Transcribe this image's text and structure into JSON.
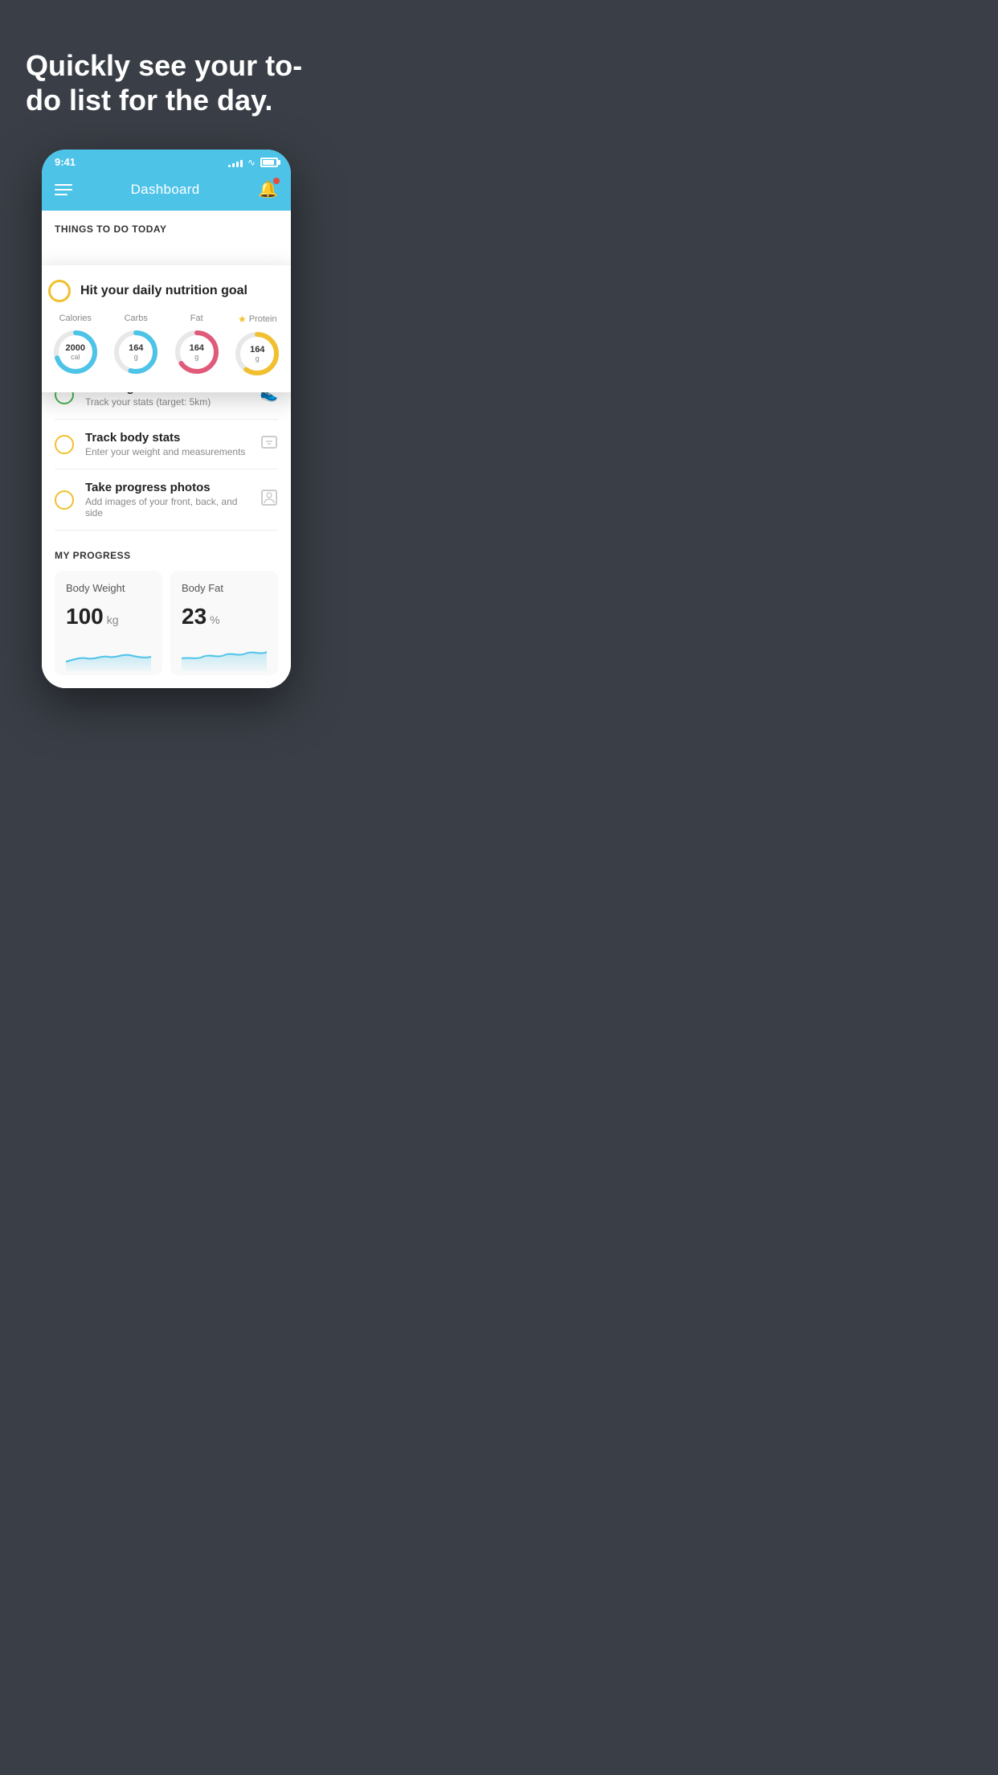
{
  "hero": {
    "title": "Quickly see your to-do list for the day."
  },
  "phone": {
    "status_bar": {
      "time": "9:41",
      "signal_bars": [
        3,
        5,
        7,
        9,
        11
      ],
      "battery_percent": 80
    },
    "header": {
      "title": "Dashboard",
      "menu_icon": "hamburger",
      "notification_icon": "bell"
    },
    "things_to_do": {
      "section_label": "THINGS TO DO TODAY"
    },
    "nutrition_card": {
      "title": "Hit your daily nutrition goal",
      "metrics": [
        {
          "label": "Calories",
          "value": "2000",
          "unit": "cal",
          "color": "#4dc3e8",
          "progress": 0.7
        },
        {
          "label": "Carbs",
          "value": "164",
          "unit": "g",
          "color": "#4dc3e8",
          "progress": 0.55
        },
        {
          "label": "Fat",
          "value": "164",
          "unit": "g",
          "color": "#e05b7a",
          "progress": 0.65
        },
        {
          "label": "Protein",
          "value": "164",
          "unit": "g",
          "color": "#f0c030",
          "progress": 0.6,
          "has_star": true
        }
      ]
    },
    "todo_items": [
      {
        "id": "running",
        "title": "Running",
        "subtitle": "Track your stats (target: 5km)",
        "icon": "shoe",
        "circle_color": "green"
      },
      {
        "id": "body-stats",
        "title": "Track body stats",
        "subtitle": "Enter your weight and measurements",
        "icon": "scale",
        "circle_color": "yellow"
      },
      {
        "id": "progress-photos",
        "title": "Take progress photos",
        "subtitle": "Add images of your front, back, and side",
        "icon": "person",
        "circle_color": "yellow"
      }
    ],
    "progress": {
      "section_label": "MY PROGRESS",
      "cards": [
        {
          "id": "body-weight",
          "title": "Body Weight",
          "value": "100",
          "unit": "kg"
        },
        {
          "id": "body-fat",
          "title": "Body Fat",
          "value": "23",
          "unit": "%"
        }
      ]
    }
  }
}
